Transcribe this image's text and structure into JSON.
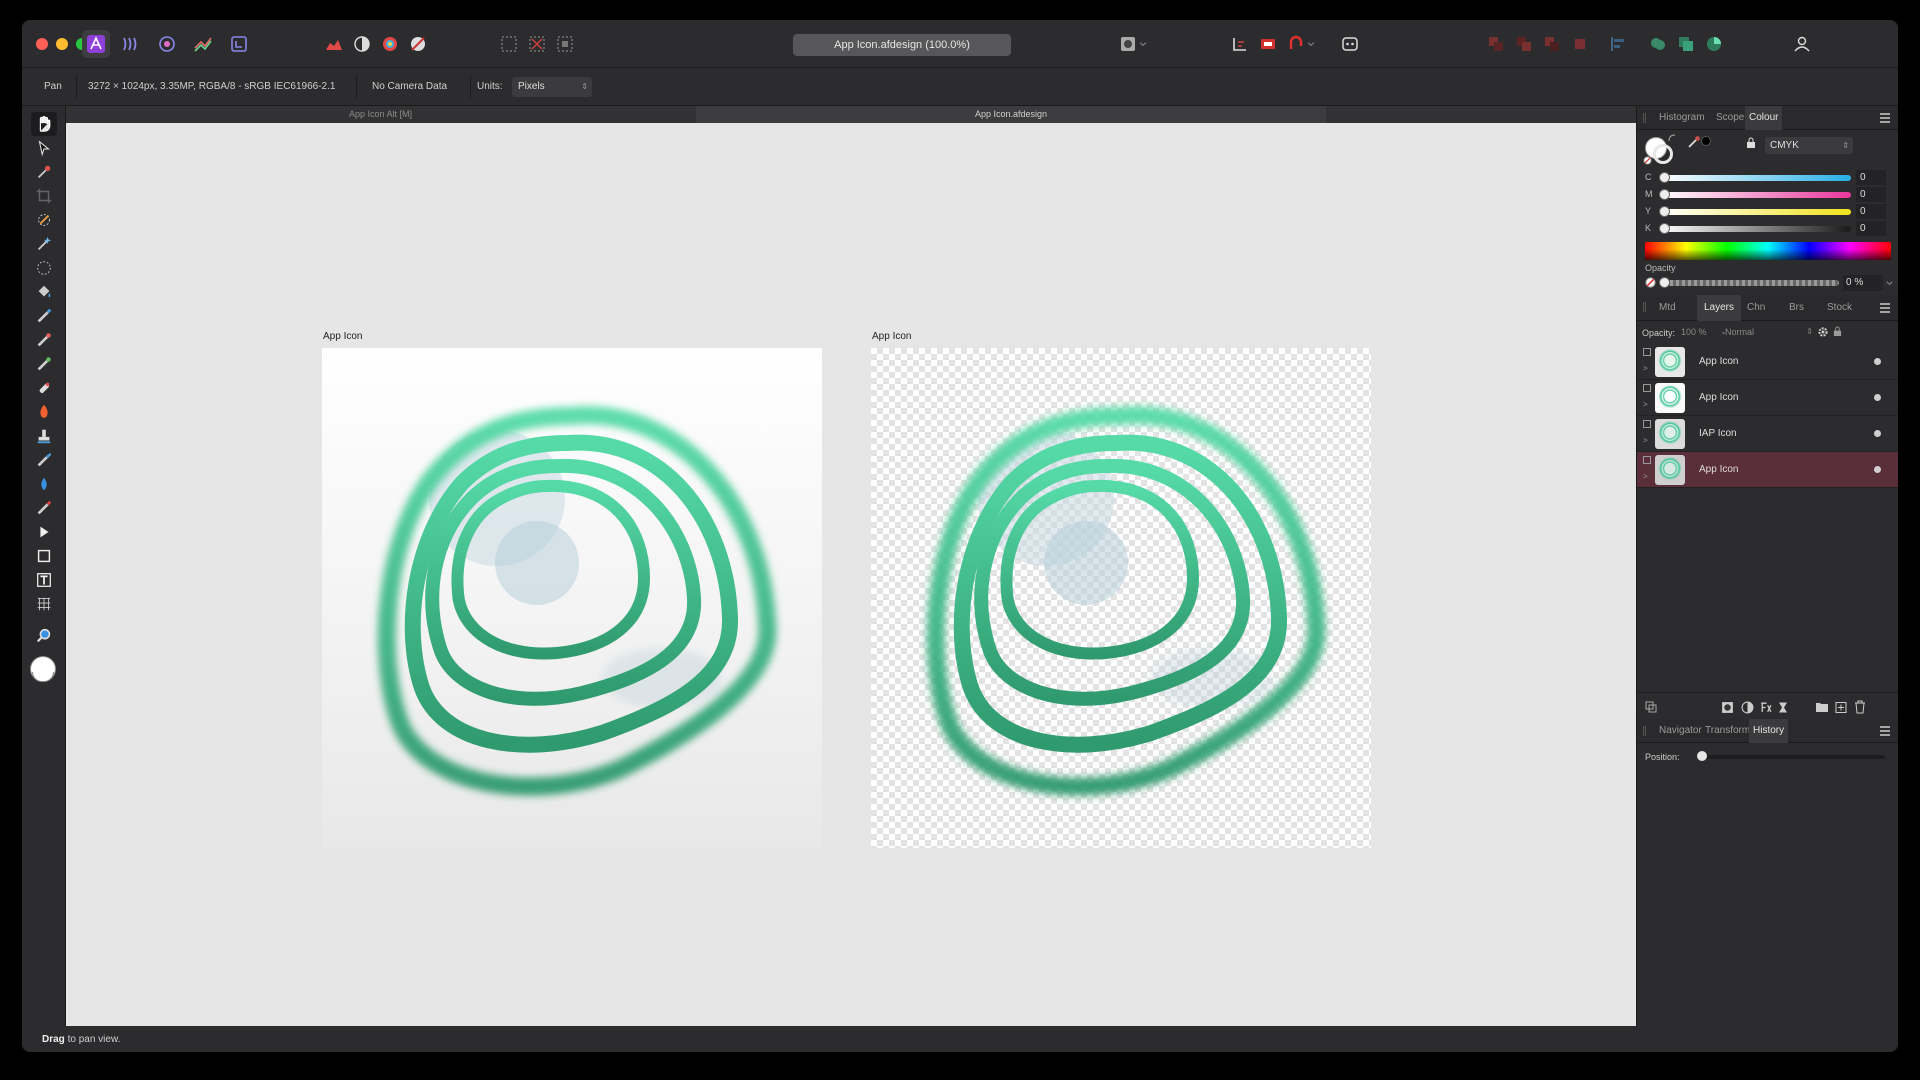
{
  "window": {
    "title": "App Icon.afdesign (100.0%)"
  },
  "context_bar": {
    "tool": "Pan",
    "doc_info": "3272 × 1024px, 3.35MP, RGBA/8 - sRGB IEC61966-2.1",
    "camera": "No Camera Data",
    "units_label": "Units:",
    "units_value": "Pixels"
  },
  "doc_tabs": [
    {
      "label": "App Icon Alt [M]"
    },
    {
      "label": "App Icon.afdesign"
    }
  ],
  "canvas": {
    "artboards": [
      {
        "label": "App Icon"
      },
      {
        "label": "App Icon"
      }
    ]
  },
  "status": {
    "bold": "Drag",
    "text": " to pan view."
  },
  "colour_panel": {
    "tabs": [
      "Histogram",
      "Scope",
      "Colour"
    ],
    "model": "CMYK",
    "channels": [
      {
        "letter": "C",
        "value": "0",
        "color": "#27aee6"
      },
      {
        "letter": "M",
        "value": "0",
        "color": "#e8369b"
      },
      {
        "letter": "Y",
        "value": "0",
        "color": "#f0e21a"
      },
      {
        "letter": "K",
        "value": "0",
        "color": "#2a2a2a"
      }
    ],
    "opacity_label": "Opacity",
    "opacity_value": "0 %"
  },
  "layers_panel": {
    "tabs": [
      "Mtd",
      "Layers",
      "Chn",
      "Brs",
      "Stock"
    ],
    "opacity_label": "Opacity:",
    "opacity_value": "100 %",
    "blend_mode": "Normal",
    "layers": [
      {
        "name": "App Icon",
        "selected": false
      },
      {
        "name": "App Icon",
        "selected": false
      },
      {
        "name": "IAP Icon",
        "selected": false
      },
      {
        "name": "App Icon",
        "selected": true
      }
    ]
  },
  "history_panel": {
    "tabs": [
      "Navigator",
      "Transform",
      "History"
    ],
    "position_label": "Position:"
  },
  "colors": {
    "accent": "#9b59e8",
    "icon_green": "#3ecf9a",
    "selected_layer": "#5a2e3a"
  }
}
